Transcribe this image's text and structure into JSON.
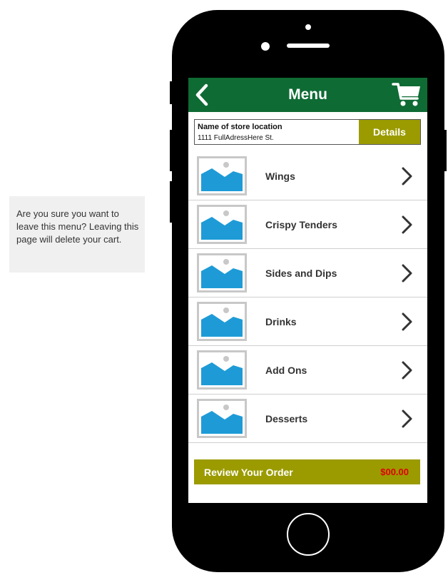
{
  "note": {
    "text": "Are you sure you want to leave this menu? Leaving this page will delete your cart."
  },
  "header": {
    "title": "Menu",
    "back_icon": "chevron-left-icon",
    "cart_icon": "shopping-cart-icon"
  },
  "store": {
    "name": "Name of store location",
    "address": "1111 FullAdressHere St.",
    "details_label": "Details"
  },
  "menu": {
    "items": [
      {
        "label": "Wings"
      },
      {
        "label": "Crispy Tenders"
      },
      {
        "label": "Sides and Dips"
      },
      {
        "label": "Drinks"
      },
      {
        "label": "Add Ons"
      },
      {
        "label": "Desserts"
      }
    ],
    "thumbnail_icon": "image-placeholder-icon",
    "arrow_icon": "chevron-right-icon"
  },
  "review": {
    "label": "Review Your Order",
    "total": "$00.00"
  },
  "colors": {
    "header_green": "#0e6b34",
    "olive": "#9b9b00",
    "price_red": "#e00000",
    "image_blue": "#1e9bd7"
  }
}
